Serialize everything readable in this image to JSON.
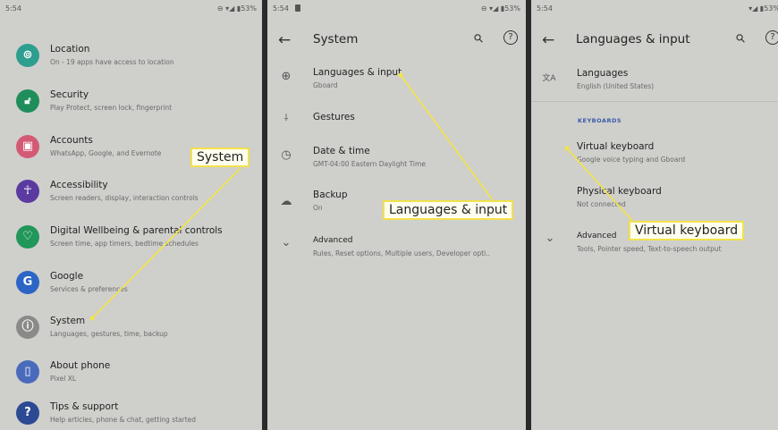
{
  "panel1": {
    "status": {
      "time": "5:54",
      "icons": "⊖ ▾◢ ▮53%"
    },
    "items": [
      {
        "title": "Location",
        "subtitle": "On - 19 apps have access to location",
        "icon": "location-icon",
        "glyph": "⊚",
        "color": "#2e9e8f"
      },
      {
        "title": "Security",
        "subtitle": "Play Protect, screen lock, fingerprint",
        "icon": "lock-icon",
        "glyph": "🔓︎",
        "color": "#1e8e5a"
      },
      {
        "title": "Accounts",
        "subtitle": "WhatsApp, Google, and Evernote",
        "icon": "account-icon",
        "glyph": "▣",
        "color": "#d35a75"
      },
      {
        "title": "Accessibility",
        "subtitle": "Screen readers, display, interaction controls",
        "icon": "accessibility-icon",
        "glyph": "☥",
        "color": "#5b3ba0"
      },
      {
        "title": "Digital Wellbeing & parental controls",
        "subtitle": "Screen time, app timers, bedtime schedules",
        "icon": "wellbeing-icon",
        "glyph": "♡",
        "color": "#21975a"
      },
      {
        "title": "Google",
        "subtitle": "Services & preferences",
        "icon": "google-icon",
        "glyph": "G",
        "color": "#2d65c6"
      },
      {
        "title": "System",
        "subtitle": "Languages, gestures, time, backup",
        "icon": "info-icon",
        "glyph": "ⓘ",
        "color": "#8a8a88"
      },
      {
        "title": "About phone",
        "subtitle": "Pixel XL",
        "icon": "phone-icon",
        "glyph": "▯",
        "color": "#4a6bbb"
      },
      {
        "title": "Tips & support",
        "subtitle": "Help articles, phone & chat, getting started",
        "icon": "help-icon",
        "glyph": "?",
        "color": "#2c4a93"
      }
    ],
    "callout": "System"
  },
  "panel2": {
    "status": {
      "time": "5:54",
      "icons": "⊖ ▾◢ ▮53%"
    },
    "title": "System",
    "back_glyph": "←",
    "search_glyph": "⚲",
    "help_glyph": "?",
    "items": [
      {
        "title": "Languages & input",
        "subtitle": "Gboard",
        "icon": "globe-icon",
        "glyph": "⊕"
      },
      {
        "title": "Gestures",
        "subtitle": "",
        "icon": "gestures-icon",
        "glyph": "⸸"
      },
      {
        "title": "Date & time",
        "subtitle": "GMT-04:00 Eastern Daylight Time",
        "icon": "clock-icon",
        "glyph": "◷"
      },
      {
        "title": "Backup",
        "subtitle": "On",
        "icon": "backup-icon",
        "glyph": "☁"
      },
      {
        "title": "Advanced",
        "subtitle": "Rules, Reset options, Multiple users, Developer opti..",
        "icon": "chevron-down-icon",
        "glyph": "⌄"
      }
    ],
    "callout": "Languages & input"
  },
  "panel3": {
    "status": {
      "time": "5:54",
      "icons": "▾◢ ▮53%"
    },
    "title": "Languages & input",
    "back_glyph": "←",
    "search_glyph": "⚲",
    "help_glyph": "?",
    "languages": {
      "title": "Languages",
      "subtitle": "English (United States)",
      "icon": "translate-icon",
      "glyph": "文A"
    },
    "section_label": "KEYBOARDS",
    "items": [
      {
        "title": "Virtual keyboard",
        "subtitle": "Google voice typing and Gboard"
      },
      {
        "title": "Physical keyboard",
        "subtitle": "Not connected"
      },
      {
        "title": "Advanced",
        "subtitle": "Tools, Pointer speed, Text-to-speech output",
        "icon": "chevron-down-icon",
        "glyph": "⌄"
      }
    ],
    "callout": "Virtual keyboard"
  },
  "colors": {
    "callout_border": "#f2e24a",
    "callout_line": "#f4e443",
    "accent": "#3b5ba8"
  }
}
